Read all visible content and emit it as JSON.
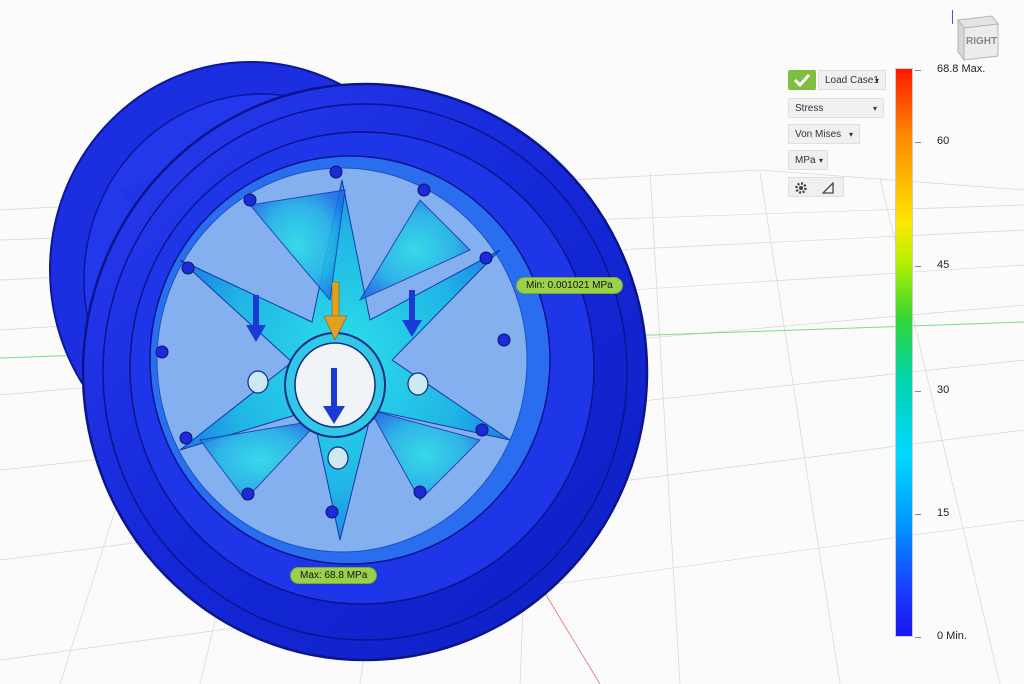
{
  "viewport": {
    "model": "wheel-stress-result",
    "callouts": {
      "min_label": "Min: 0.001021 MPa",
      "max_label": "Max: 68.8 MPa"
    }
  },
  "result_panel": {
    "load_case": "Load Case1",
    "result_type": "Stress",
    "stress_component": "Von Mises",
    "units": "MPa"
  },
  "legend": {
    "max_label": "68.8 Max.",
    "ticks": [
      "60",
      "45",
      "30",
      "15"
    ],
    "min_label": "0 Min."
  },
  "view_cube": {
    "face_label": "RIGHT"
  },
  "colors": {
    "accent_check": "#7fbf3f",
    "callout_bg": "#9bd14a",
    "model_blue": "#1f2bd6"
  }
}
